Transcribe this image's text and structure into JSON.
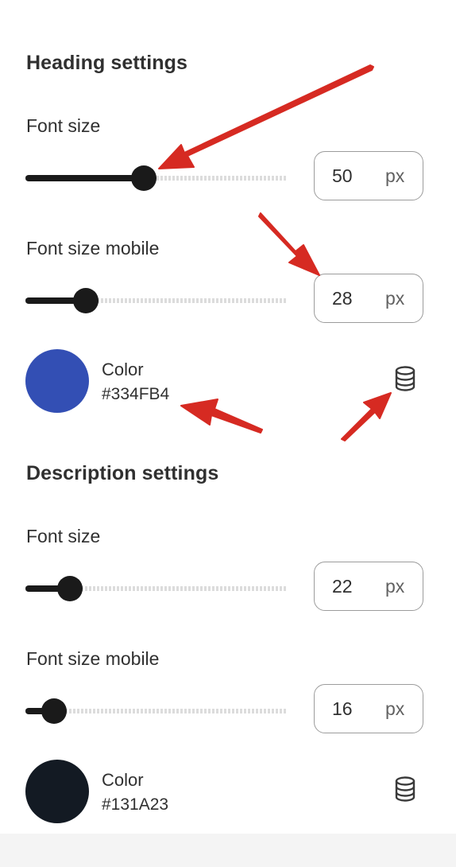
{
  "heading": {
    "title": "Heading settings",
    "font_size": {
      "label": "Font size",
      "value": "50",
      "unit": "px",
      "slider_fraction": 0.45
    },
    "font_size_mobile": {
      "label": "Font size mobile",
      "value": "28",
      "unit": "px",
      "slider_fraction": 0.23
    },
    "color": {
      "label": "Color",
      "hex": "#334FB4",
      "swatch": "#334FB4",
      "icon": "database-icon"
    }
  },
  "description": {
    "title": "Description settings",
    "font_size": {
      "label": "Font size",
      "value": "22",
      "unit": "px",
      "slider_fraction": 0.17
    },
    "font_size_mobile": {
      "label": "Font size mobile",
      "value": "16",
      "unit": "px",
      "slider_fraction": 0.11
    },
    "color": {
      "label": "Color",
      "hex": "#131A23",
      "swatch": "#131A23",
      "icon": "database-icon"
    }
  },
  "annotation_color": "#d62a22"
}
